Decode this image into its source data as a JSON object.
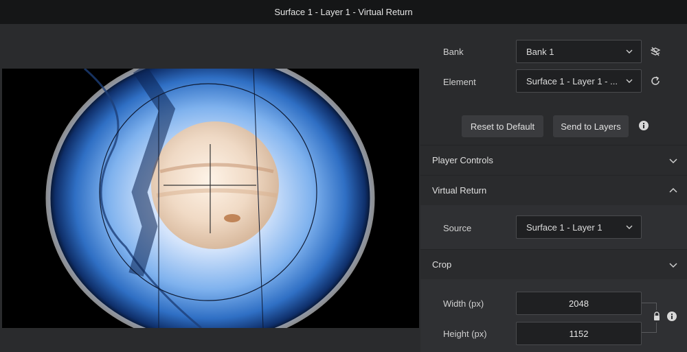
{
  "window": {
    "title": "Surface 1 - Layer 1 - Virtual Return"
  },
  "bank": {
    "label": "Bank",
    "value": "Bank 1"
  },
  "element": {
    "label": "Element",
    "value": "Surface 1 - Layer 1 - ..."
  },
  "actions": {
    "reset_label": "Reset to Default",
    "send_label": "Send to Layers"
  },
  "sections": {
    "player_controls": "Player Controls",
    "virtual_return": "Virtual Return",
    "crop": "Crop"
  },
  "source": {
    "label": "Source",
    "value": "Surface 1 - Layer 1"
  },
  "crop": {
    "width_label": "Width (px)",
    "width_value": "2048",
    "height_label": "Height (px)",
    "height_value": "1152"
  },
  "colors": {
    "panel_bg": "#2a2b2d",
    "field_bg": "#1f2022",
    "button_bg": "#3a3b3e",
    "titlebar_bg": "#151617"
  },
  "icons": [
    "chevron-down-icon",
    "layers-off-icon",
    "refresh-icon",
    "info-icon",
    "chevron-up-icon",
    "lock-icon"
  ]
}
